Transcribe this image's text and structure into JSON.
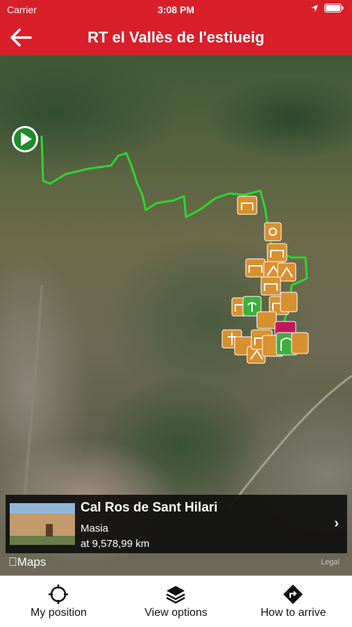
{
  "status_bar": {
    "carrier": "Carrier",
    "time": "3:08 PM"
  },
  "nav": {
    "title": "RT el Vallès de l'estiueig",
    "back_icon": "arrow-left-icon"
  },
  "map": {
    "attribution": "Maps",
    "legal": "Legal",
    "route_color": "#2ed62e",
    "poi_color": "#d9902f",
    "start_color": "#1f8b2b"
  },
  "poi_card": {
    "name": "Cal Ros de Sant Hilari",
    "type": "Masia",
    "distance": "at 9,578,99 km"
  },
  "toolbar": {
    "my_position": "My position",
    "view_options": "View options",
    "how_to_arrive": "How to arrive"
  },
  "colors": {
    "brand": "#d81f2a"
  }
}
